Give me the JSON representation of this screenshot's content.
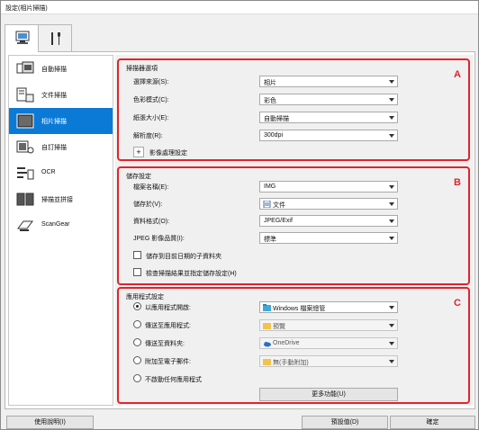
{
  "window": {
    "title": "設定(相片掃描)"
  },
  "tabs": [
    {
      "icon": "scanner-computer-icon",
      "active": true
    },
    {
      "icon": "tools-icon",
      "active": false
    }
  ],
  "sidebar": {
    "items": [
      {
        "label": "自動掃描",
        "icon": "auto-scan-icon",
        "active": false
      },
      {
        "label": "文件掃描",
        "icon": "document-scan-icon",
        "active": false
      },
      {
        "label": "相片掃描",
        "icon": "photo-scan-icon",
        "active": true
      },
      {
        "label": "自訂掃描",
        "icon": "custom-scan-icon",
        "active": false
      },
      {
        "label": "OCR",
        "icon": "ocr-icon",
        "active": false
      },
      {
        "label": "掃描並拼接",
        "icon": "stitch-icon",
        "active": false
      },
      {
        "label": "ScanGear",
        "icon": "scangear-icon",
        "active": false
      }
    ]
  },
  "scanner_options": {
    "title": "掃描器選項",
    "letter": "A",
    "select_source": {
      "label": "選擇來源(S):",
      "value": "相片"
    },
    "color_mode": {
      "label": "色彩模式(C):",
      "value": "彩色"
    },
    "paper_size": {
      "label": "紙張大小(E):",
      "value": "自動掃描"
    },
    "resolution": {
      "label": "解析度(R):",
      "value": "300dpi"
    },
    "image_processing": {
      "label": "影像處理設定"
    }
  },
  "save_settings": {
    "title": "儲存設定",
    "letter": "B",
    "file_name": {
      "label": "檔案名稱(E):",
      "value": "IMG"
    },
    "save_in": {
      "label": "儲存於(V):",
      "value": "文件"
    },
    "data_format": {
      "label": "資料格式(O):",
      "value": "JPEG/Exif"
    },
    "jpeg_quality": {
      "label": "JPEG 影像品質(I):",
      "value": "標準"
    },
    "save_subfolder": {
      "label": "儲存到目前日期的子資料夾",
      "checked": false
    },
    "check_results": {
      "label": "檢查掃描結果並指定儲存設定(H)",
      "checked": false
    }
  },
  "app_settings": {
    "title": "應用程式設定",
    "letter": "C",
    "open_with": {
      "label": "以應用程式開啟:",
      "value": "Windows 檔案總管",
      "selected": true
    },
    "send_to_app": {
      "label": "傳送至應用程式:",
      "value": "預覽",
      "selected": false
    },
    "send_to_folder": {
      "label": "傳送至資料夾:",
      "value": "OneDrive",
      "selected": false
    },
    "attach_email": {
      "label": "附加至電子郵件:",
      "value": "無(手動附加)",
      "selected": false
    },
    "do_not_start": {
      "label": "不啟動任何應用程式",
      "selected": false
    },
    "more_functions": {
      "label": "更多功能(U)"
    }
  },
  "footer": {
    "instructions": "使用說明(I)",
    "defaults": "預設值(D)",
    "ok": "確定"
  }
}
